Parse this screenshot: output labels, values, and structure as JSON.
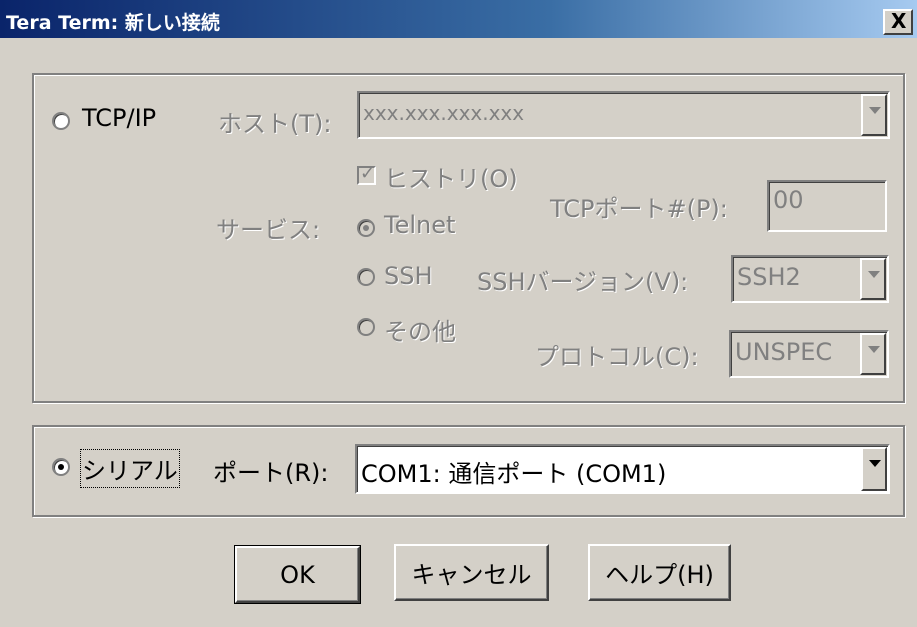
{
  "window": {
    "title": "Tera Term: 新しい接続",
    "close_label": "X"
  },
  "tcp": {
    "radio_label": "TCP/IP",
    "selected": false,
    "host_label": "ホスト(T):",
    "host_value": "xxx.xxx.xxx.xxx",
    "history_label": "ヒストリ(O)",
    "history_checked": true,
    "service_label": "サービス:",
    "telnet_label": "Telnet",
    "ssh_label": "SSH",
    "other_label": "その他",
    "tcp_port_label": "TCPポート#(P):",
    "tcp_port_value": "00",
    "ssh_version_label": "SSHバージョン(V):",
    "ssh_version_value": "SSH2",
    "protocol_label": "プロトコル(C):",
    "protocol_value": "UNSPEC",
    "service_selected": "Telnet"
  },
  "serial": {
    "radio_label": "シリアル",
    "selected": true,
    "port_label": "ポート(R):",
    "port_value": "COM1: 通信ポート (COM1)"
  },
  "buttons": {
    "ok": "OK",
    "cancel": "キャンセル",
    "help": "ヘルプ(H)"
  },
  "colors": {
    "title_start": "#0a246a",
    "title_end": "#a6caf0",
    "face": "#d4d0c8",
    "disabled_text": "#808080"
  }
}
